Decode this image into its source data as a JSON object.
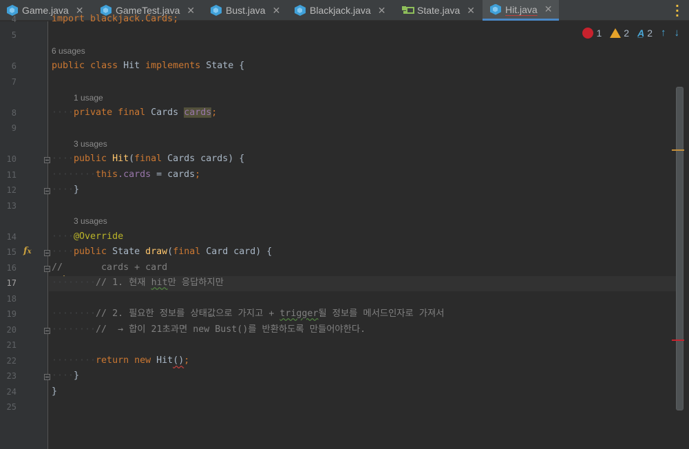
{
  "tabs": [
    {
      "label": "Game.java",
      "icon": "java-class-icon",
      "active": false
    },
    {
      "label": "GameTest.java",
      "icon": "java-class-icon",
      "active": false
    },
    {
      "label": "Bust.java",
      "icon": "java-class-icon",
      "active": false
    },
    {
      "label": "Blackjack.java",
      "icon": "java-class-icon",
      "active": false
    },
    {
      "label": "State.java",
      "icon": "java-interface-icon",
      "active": false
    },
    {
      "label": "Hit.java",
      "icon": "java-class-icon",
      "active": true
    }
  ],
  "tab_close_glyph": "✕",
  "inspections": {
    "errors": "1",
    "warnings": "2",
    "typos": "2"
  },
  "line_numbers": [
    "4",
    "5",
    "6",
    "7",
    "8",
    "9",
    "10",
    "11",
    "12",
    "13",
    "14",
    "15",
    "16",
    "17",
    "18",
    "19",
    "20",
    "21",
    "22",
    "23",
    "24",
    "25"
  ],
  "current_line": "17",
  "hints": {
    "class_usages": "6 usages",
    "field_usages": "1 usage",
    "ctor_usages": "3 usages",
    "method_usages": "3 usages"
  },
  "code": {
    "l4": "import blackjack.Cards;",
    "l6_kw1": "public",
    "l6_kw2": "class",
    "l6_name": "Hit",
    "l6_kw3": "implements",
    "l6_iface": "State {",
    "l8_kw1": "private",
    "l8_kw2": "final",
    "l8_type": "Cards",
    "l8_field": "cards",
    "l10_kw": "public",
    "l10_fn": "Hit",
    "l10_rest1": "(",
    "l10_final": "final",
    "l10_rest2": " Cards cards) {",
    "l11_this": "this",
    "l11_field": ".cards",
    "l11_rest": " = cards",
    "l12": "}",
    "l14": "@Override",
    "l15_kw": "public",
    "l15_type": "State",
    "l15_fn": "draw",
    "l15_final": "final",
    "l15_rest": " Card card) {",
    "l16": "//       cards + card",
    "l17_a": "// 1. 현재 ",
    "l17_b": "hit",
    "l17_c": "만 응답하지만",
    "l19_a": "// 2. 필요한 정보를 상태값으로 가지고 + ",
    "l19_b": "trigger",
    "l19_c": "될 정보를 메서드인자로 가져서",
    "l20": "//  → 합이 21초과면 new Bust()를 반환하도록 만들어야한다.",
    "l22_ret": "return",
    "l22_new": "new",
    "l22_name": "Hit",
    "l22_paren": "()",
    "l23": "}",
    "l24": "}"
  }
}
